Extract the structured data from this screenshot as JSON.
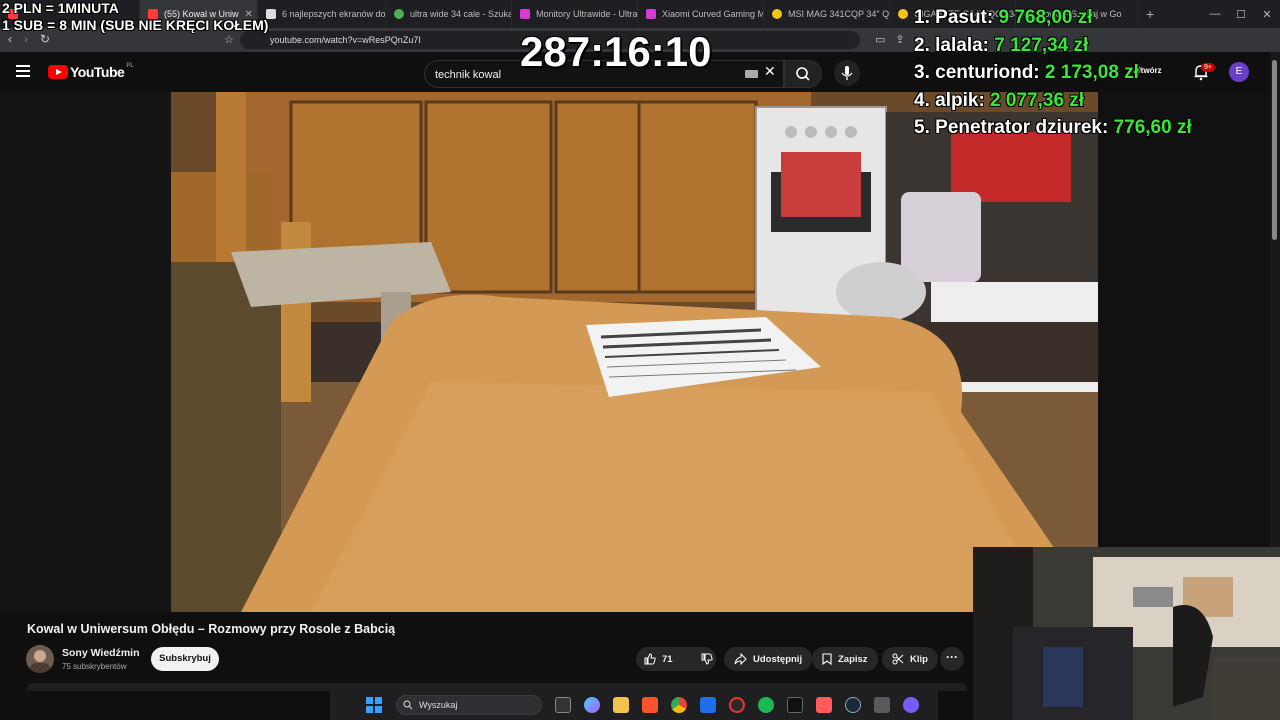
{
  "overlay": {
    "rate_line1": "2 PLN = 1MINUTA",
    "rate_line2": "1 SUB = 8 MIN (SUB NIE KRĘCI KOŁEM)",
    "timer": "287:16:10",
    "leaderboard": [
      {
        "rank": "1.",
        "name": "Pasut:",
        "amount": "9 768,00 zł"
      },
      {
        "rank": "2.",
        "name": "lalala:",
        "amount": "7 127,34 zł"
      },
      {
        "rank": "3.",
        "name": "centuriond:",
        "amount": "2 173,08 zł"
      },
      {
        "rank": "4.",
        "name": "alpik:",
        "amount": "2 077,36 zł"
      },
      {
        "rank": "5.",
        "name": "Penetrator dziurek:",
        "amount": "776,60 zł"
      }
    ]
  },
  "browser": {
    "tabs": [
      {
        "label": "(55) Kowal w Uniw",
        "color": "#ff3b3b",
        "active": true
      },
      {
        "label": "6 najlepszych ekranów do",
        "color": "#dddddd",
        "active": false
      },
      {
        "label": "ultra wide 34 cale - Szukaj",
        "color": "#4caf50",
        "active": false
      },
      {
        "label": "Monitory Ultrawide - Ultra",
        "color": "#d63bd6",
        "active": false
      },
      {
        "label": "Xiaomi Curved Gaming M",
        "color": "#d63bd6",
        "active": false
      },
      {
        "label": "MSI MAG 341CQP 34\" QD",
        "color": "#f5c518",
        "active": false
      },
      {
        "label": "GIGABYTE G34WQC2 34\"",
        "color": "#f5c518",
        "active": false
      },
      {
        "label": "kowal - Szukaj w Go",
        "color": "#4caf50",
        "active": false
      }
    ],
    "new_tab": "+",
    "url": "youtube.com/watch?v=wResPQnZu7I"
  },
  "youtube": {
    "logo_text": "YouTube",
    "logo_country": "PL",
    "search_value": "technik kowal",
    "create_label": "Utwórz",
    "notif_count": "9+",
    "avatar_letter": "E",
    "video_title": "Kowal w Uniwersum Obłędu – Rozmowy przy Rosole z Babcią",
    "channel_name": "Sony Wiedźmin",
    "channel_subs": "75 subskrybentów",
    "subscribe_label": "Subskrybuj",
    "like_count": "71",
    "share_label": "Udostępnij",
    "save_label": "Zapisz",
    "clip_label": "Klip",
    "more_label": "···"
  },
  "taskbar": {
    "search_placeholder": "Wyszukaj"
  }
}
